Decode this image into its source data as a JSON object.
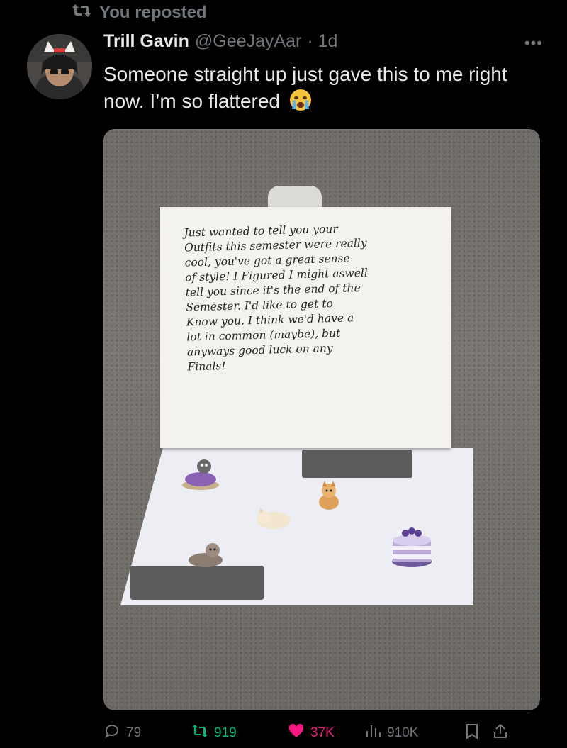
{
  "repost": {
    "label": "You reposted"
  },
  "author": {
    "name": "Trill Gavin",
    "handle": "@GeeJayAar",
    "time": "· 1d"
  },
  "tweet": {
    "text": "Someone straight up just gave this to me right now. I’m so flattered"
  },
  "note": {
    "text": "Just wanted to tell you your\nOutfits this semester were really\ncool, you've got a great sense\nof style! I Figured I might aswell\ntell you since it's the end of the\nSemester. I'd like to get to\nKnow you, I think we'd have a\nlot in common (maybe), but\nanyways good luck on any\nFinals!"
  },
  "actions": {
    "replies": "79",
    "reposts": "919",
    "likes": "37K",
    "views": "910K"
  },
  "colors": {
    "background": "#000000",
    "text": "#e7e9ea",
    "muted": "#71767b",
    "repost_green": "#00ba7c",
    "like_pink": "#f91880"
  },
  "icons": [
    "repost-icon",
    "more-icon",
    "crying-face-emoji",
    "reply-icon",
    "repost-icon",
    "heart-icon",
    "views-icon",
    "bookmark-icon",
    "share-icon"
  ]
}
